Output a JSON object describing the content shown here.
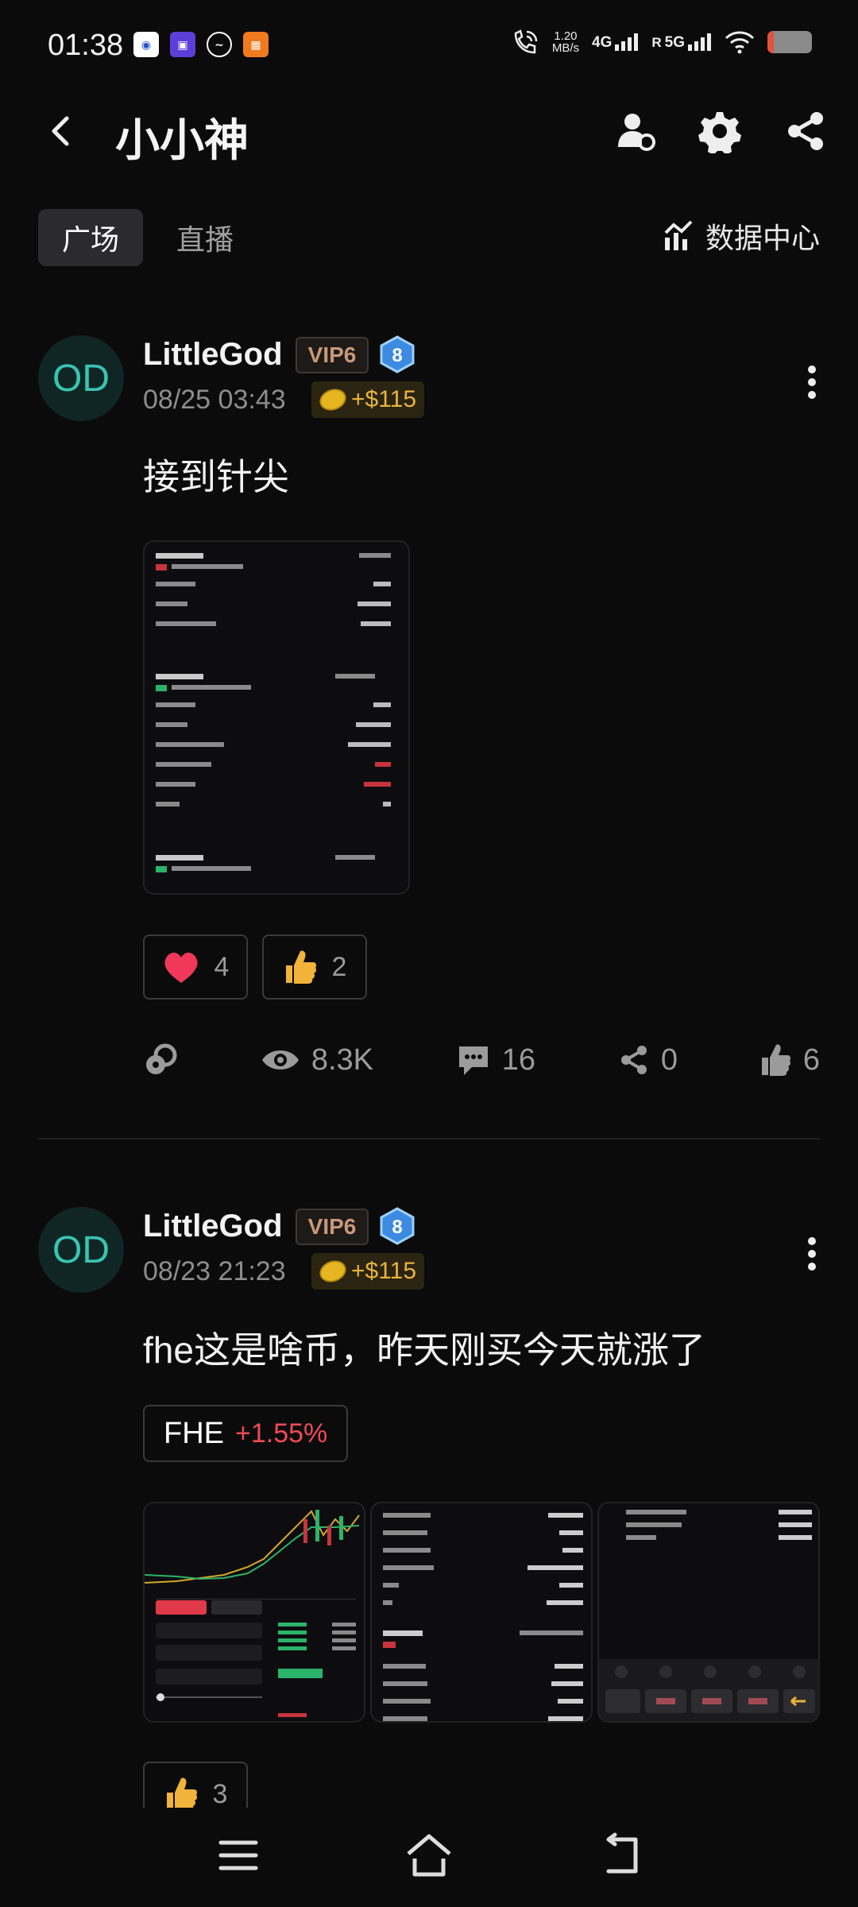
{
  "status_bar": {
    "time": "01:38",
    "speed_value": "1.20",
    "speed_unit": "MB/s",
    "network_1": "4G",
    "network_2": "5G",
    "roaming": "R",
    "battery_level": 0.15
  },
  "header": {
    "title": "小小神"
  },
  "tabs": {
    "square": "广场",
    "live": "直播",
    "data_center": "数据中心"
  },
  "posts": [
    {
      "avatar_text": "OD",
      "username": "LittleGod",
      "vip": "VIP6",
      "level": "8",
      "time": "08/25 03:43",
      "reward": "+$115",
      "content": "接到针尖",
      "reactions": [
        {
          "icon": "heart-icon",
          "count": "4"
        },
        {
          "icon": "thumbs-up-icon",
          "count": "2"
        }
      ],
      "stats": {
        "views": "8.3K",
        "comments": "16",
        "shares": "0",
        "likes": "6"
      }
    },
    {
      "avatar_text": "OD",
      "username": "LittleGod",
      "vip": "VIP6",
      "level": "8",
      "time": "08/23 21:23",
      "reward": "+$115",
      "content": "fhe这是啥币，昨天刚买今天就涨了",
      "coin_tag": {
        "symbol": "FHE",
        "change": "+1.55%"
      },
      "reactions": [
        {
          "icon": "thumbs-up-icon",
          "count": "3"
        }
      ]
    }
  ],
  "colors": {
    "background": "#0b0b0b",
    "avatar_text": "#39c4b0",
    "reward": "#e8b43a",
    "positive_change": "#ee4b57",
    "heart": "#f0395a"
  }
}
